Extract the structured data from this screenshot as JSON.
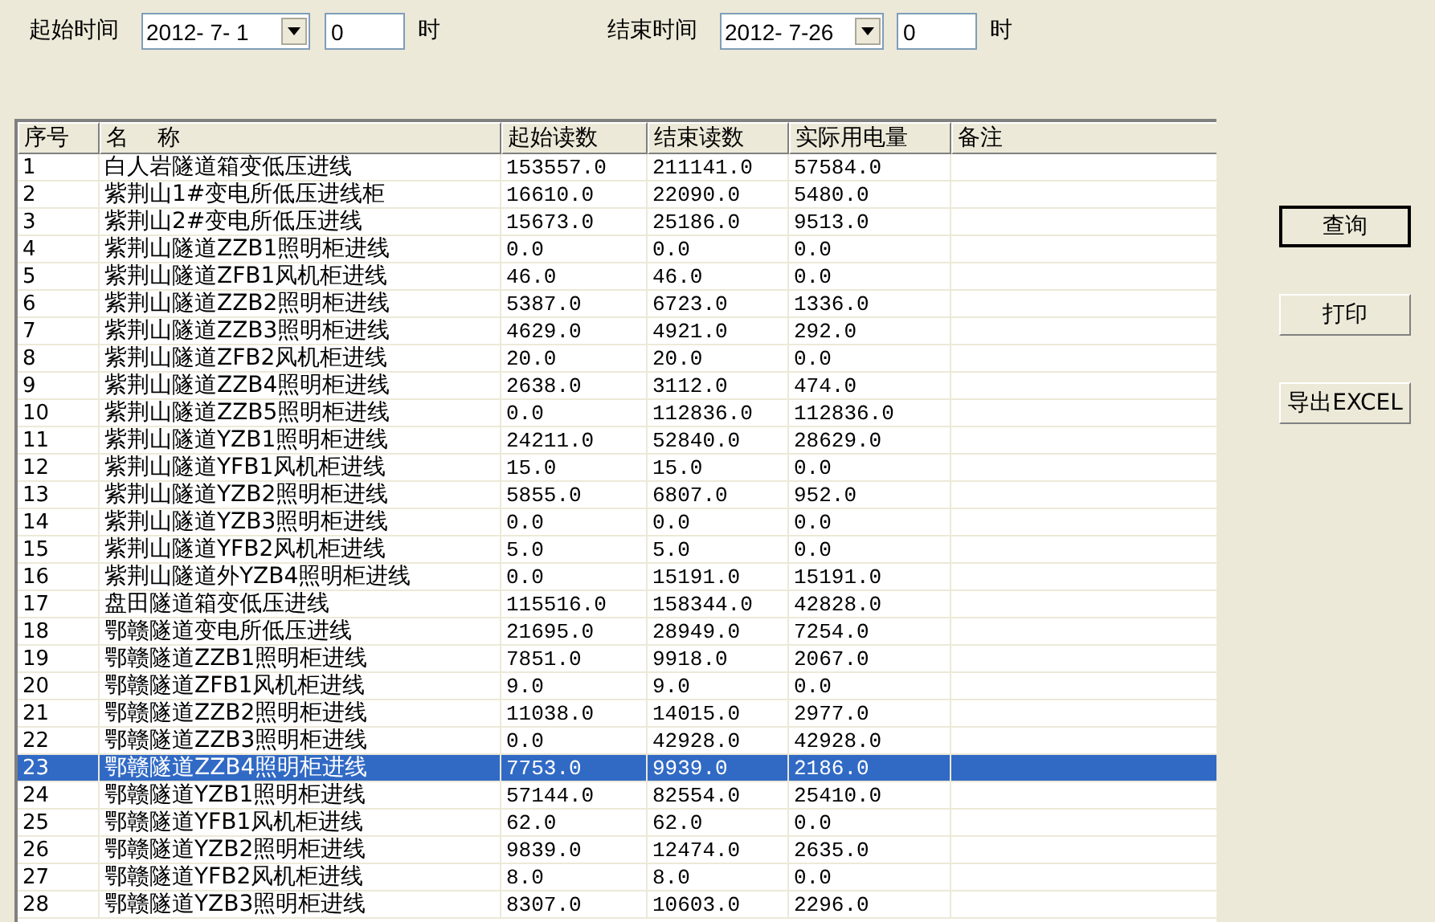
{
  "filters": {
    "start_label": "起始时间",
    "start_date": "2012- 7- 1",
    "start_hour": "0",
    "start_hour_unit": "时",
    "end_label": "结束时间",
    "end_date": "2012- 7-26",
    "end_hour": "0",
    "end_hour_unit": "时"
  },
  "table": {
    "columns": [
      "序号",
      "名    称",
      "起始读数",
      "结束读数",
      "实际用电量",
      "备注"
    ],
    "rows": [
      {
        "no": "1",
        "name": "白人岩隧道箱变低压进线",
        "start": "153557.0",
        "end": "211141.0",
        "usage": "57584.0",
        "selected": false
      },
      {
        "no": "2",
        "name": "紫荆山1#变电所低压进线柜",
        "start": "16610.0",
        "end": "22090.0",
        "usage": "5480.0",
        "selected": false
      },
      {
        "no": "3",
        "name": "紫荆山2#变电所低压进线",
        "start": "15673.0",
        "end": "25186.0",
        "usage": "9513.0",
        "selected": false
      },
      {
        "no": "4",
        "name": "紫荆山隧道ZZB1照明柜进线",
        "start": "0.0",
        "end": "0.0",
        "usage": "0.0",
        "selected": false
      },
      {
        "no": "5",
        "name": "紫荆山隧道ZFB1风机柜进线",
        "start": "46.0",
        "end": "46.0",
        "usage": "0.0",
        "selected": false
      },
      {
        "no": "6",
        "name": "紫荆山隧道ZZB2照明柜进线",
        "start": "5387.0",
        "end": "6723.0",
        "usage": "1336.0",
        "selected": false
      },
      {
        "no": "7",
        "name": "紫荆山隧道ZZB3照明柜进线",
        "start": "4629.0",
        "end": "4921.0",
        "usage": "292.0",
        "selected": false
      },
      {
        "no": "8",
        "name": "紫荆山隧道ZFB2风机柜进线",
        "start": "20.0",
        "end": "20.0",
        "usage": "0.0",
        "selected": false
      },
      {
        "no": "9",
        "name": "紫荆山隧道ZZB4照明柜进线",
        "start": "2638.0",
        "end": "3112.0",
        "usage": "474.0",
        "selected": false
      },
      {
        "no": "10",
        "name": "紫荆山隧道ZZB5照明柜进线",
        "start": "0.0",
        "end": "112836.0",
        "usage": "112836.0",
        "selected": false
      },
      {
        "no": "11",
        "name": "紫荆山隧道YZB1照明柜进线",
        "start": "24211.0",
        "end": "52840.0",
        "usage": "28629.0",
        "selected": false
      },
      {
        "no": "12",
        "name": "紫荆山隧道YFB1风机柜进线",
        "start": "15.0",
        "end": "15.0",
        "usage": "0.0",
        "selected": false
      },
      {
        "no": "13",
        "name": "紫荆山隧道YZB2照明柜进线",
        "start": "5855.0",
        "end": "6807.0",
        "usage": "952.0",
        "selected": false
      },
      {
        "no": "14",
        "name": "紫荆山隧道YZB3照明柜进线",
        "start": "0.0",
        "end": "0.0",
        "usage": "0.0",
        "selected": false
      },
      {
        "no": "15",
        "name": "紫荆山隧道YFB2风机柜进线",
        "start": "5.0",
        "end": "5.0",
        "usage": "0.0",
        "selected": false
      },
      {
        "no": "16",
        "name": "紫荆山隧道外YZB4照明柜进线",
        "start": "0.0",
        "end": "15191.0",
        "usage": "15191.0",
        "selected": false
      },
      {
        "no": "17",
        "name": "盘田隧道箱变低压进线",
        "start": "115516.0",
        "end": "158344.0",
        "usage": "42828.0",
        "selected": false
      },
      {
        "no": "18",
        "name": "鄂赣隧道变电所低压进线",
        "start": "21695.0",
        "end": "28949.0",
        "usage": "7254.0",
        "selected": false
      },
      {
        "no": "19",
        "name": "鄂赣隧道ZZB1照明柜进线",
        "start": "7851.0",
        "end": "9918.0",
        "usage": "2067.0",
        "selected": false
      },
      {
        "no": "20",
        "name": "鄂赣隧道ZFB1风机柜进线",
        "start": "9.0",
        "end": "9.0",
        "usage": "0.0",
        "selected": false
      },
      {
        "no": "21",
        "name": "鄂赣隧道ZZB2照明柜进线",
        "start": "11038.0",
        "end": "14015.0",
        "usage": "2977.0",
        "selected": false
      },
      {
        "no": "22",
        "name": "鄂赣隧道ZZB3照明柜进线",
        "start": "0.0",
        "end": "42928.0",
        "usage": "42928.0",
        "selected": false
      },
      {
        "no": "23",
        "name": "鄂赣隧道ZZB4照明柜进线",
        "start": "7753.0",
        "end": "9939.0",
        "usage": "2186.0",
        "selected": true
      },
      {
        "no": "24",
        "name": "鄂赣隧道YZB1照明柜进线",
        "start": "57144.0",
        "end": "82554.0",
        "usage": "25410.0",
        "selected": false
      },
      {
        "no": "25",
        "name": "鄂赣隧道YFB1风机柜进线",
        "start": "62.0",
        "end": "62.0",
        "usage": "0.0",
        "selected": false
      },
      {
        "no": "26",
        "name": "鄂赣隧道YZB2照明柜进线",
        "start": "9839.0",
        "end": "12474.0",
        "usage": "2635.0",
        "selected": false
      },
      {
        "no": "27",
        "name": "鄂赣隧道YFB2风机柜进线",
        "start": "8.0",
        "end": "8.0",
        "usage": "0.0",
        "selected": false
      },
      {
        "no": "28",
        "name": "鄂赣隧道YZB3照明柜进线",
        "start": "8307.0",
        "end": "10603.0",
        "usage": "2296.0",
        "selected": false
      }
    ]
  },
  "buttons": [
    {
      "label": "查询",
      "default": true
    },
    {
      "label": "打印",
      "default": false
    },
    {
      "label": "导出EXCEL",
      "default": false
    }
  ]
}
